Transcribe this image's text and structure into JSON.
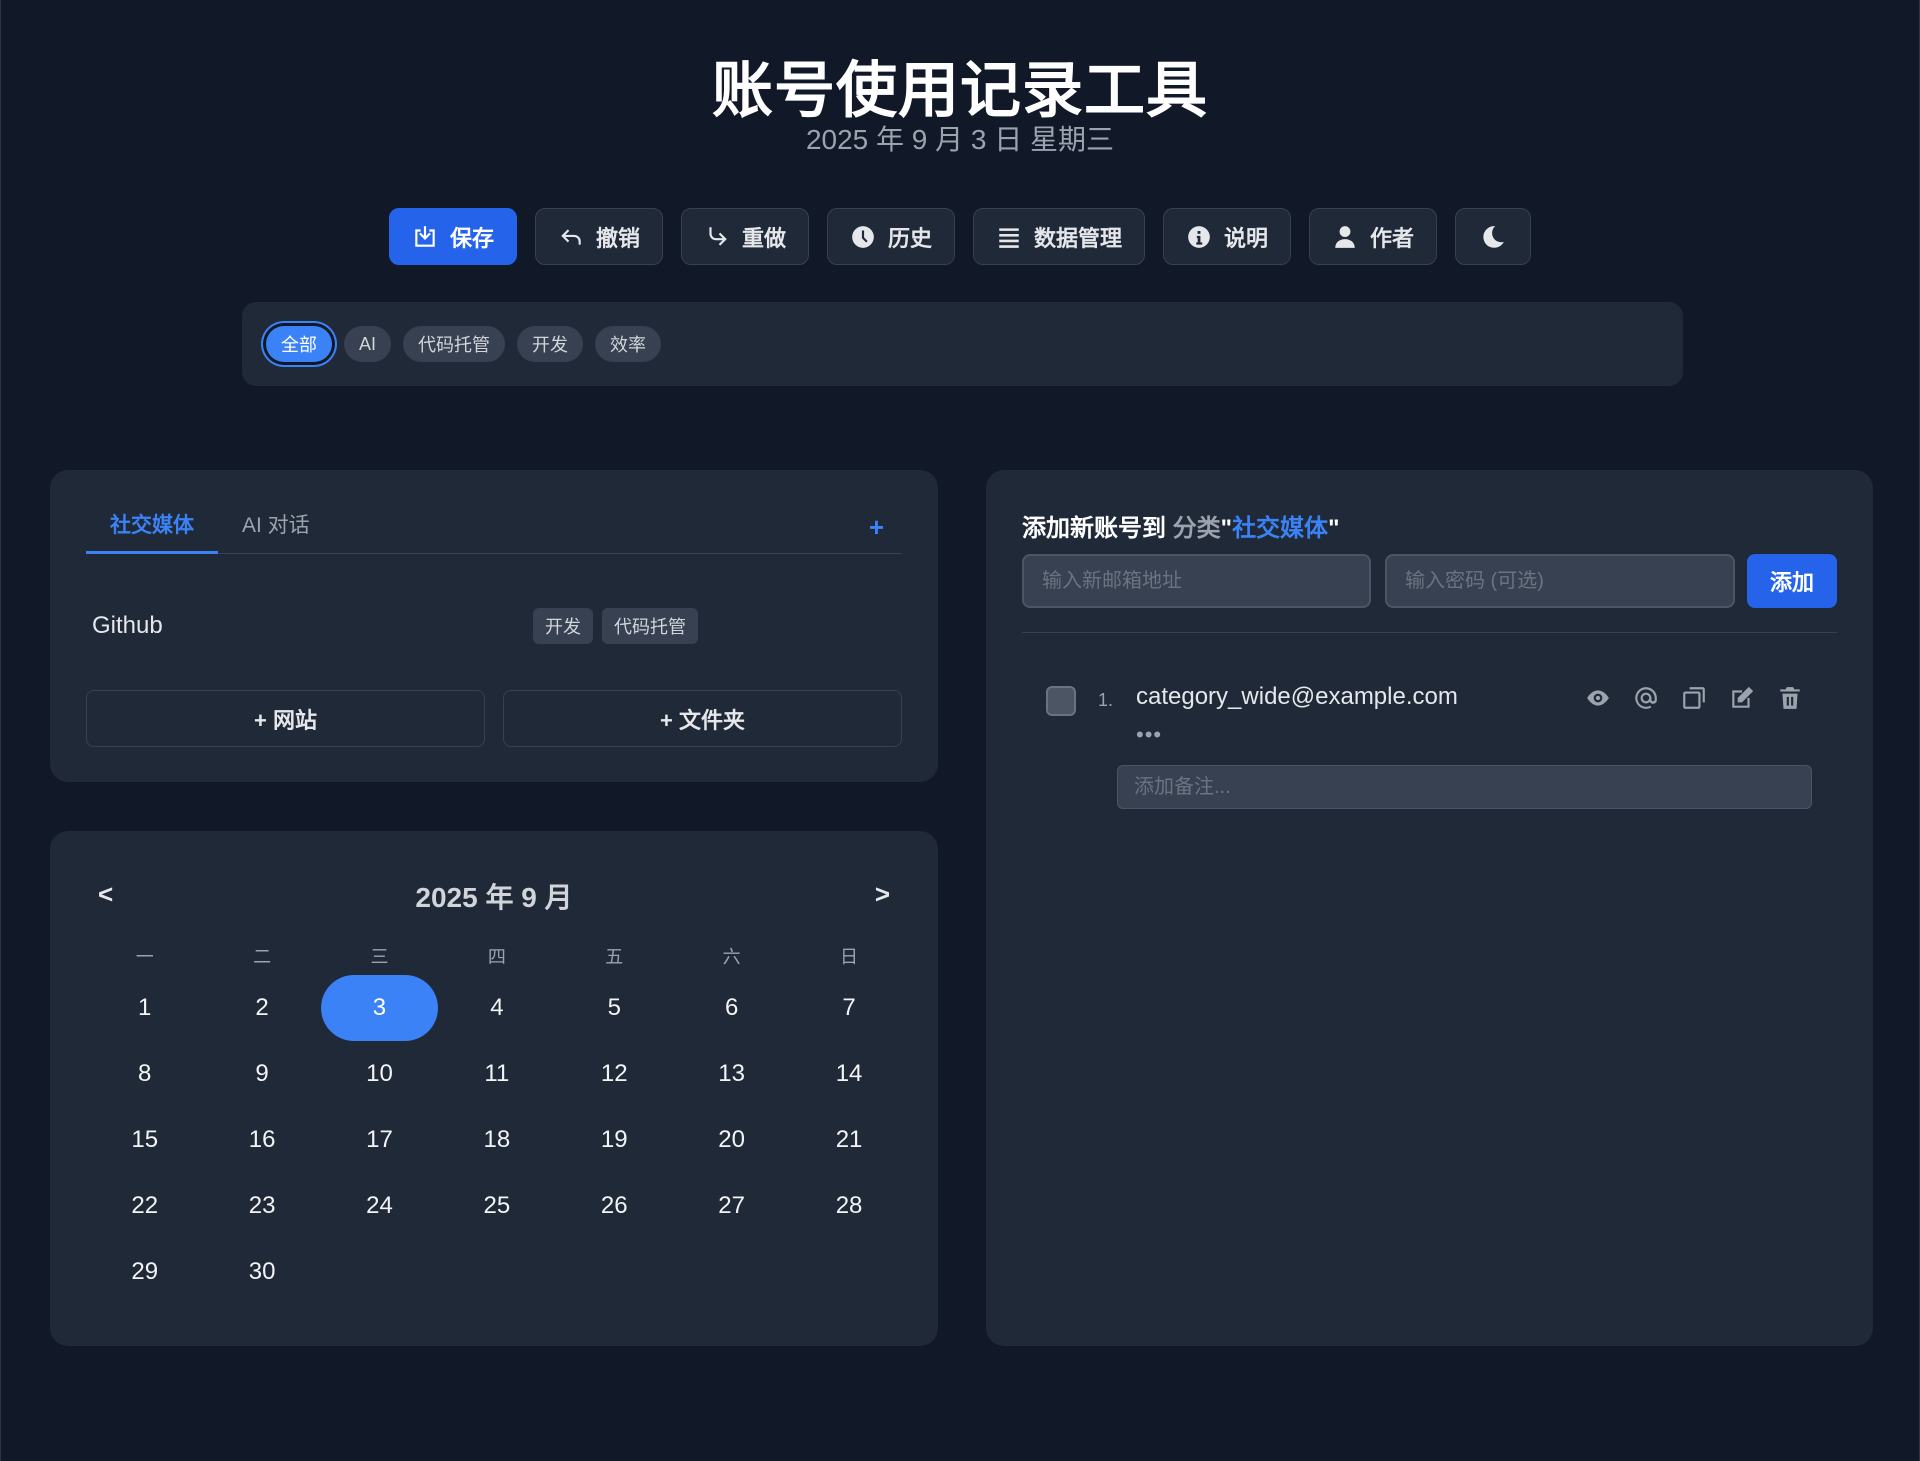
{
  "header": {
    "title": "账号使用记录工具",
    "subtitle": "2025 年 9 月 3 日 星期三"
  },
  "toolbar": {
    "save": "保存",
    "undo": "撤销",
    "redo": "重做",
    "history": "历史",
    "data_manage": "数据管理",
    "help": "说明",
    "author": "作者",
    "theme_icon": "moon-icon"
  },
  "filters": [
    "全部",
    "AI",
    "代码托管",
    "开发",
    "效率"
  ],
  "accounts_panel": {
    "tabs": [
      "社交媒体",
      "AI 对话"
    ],
    "add_tab": "+",
    "account": {
      "name": "Github",
      "tags": [
        "开发",
        "代码托管"
      ]
    },
    "add_site": "+ 网站",
    "add_folder": "+ 文件夹"
  },
  "calendar": {
    "title": "2025 年 9 月",
    "prev": "<",
    "next": ">",
    "weekdays": [
      "一",
      "二",
      "三",
      "四",
      "五",
      "六",
      "日"
    ],
    "days": [
      "1",
      "2",
      "3",
      "4",
      "5",
      "6",
      "7",
      "8",
      "9",
      "10",
      "11",
      "12",
      "13",
      "14",
      "15",
      "16",
      "17",
      "18",
      "19",
      "20",
      "21",
      "22",
      "23",
      "24",
      "25",
      "26",
      "27",
      "28",
      "29",
      "30"
    ],
    "today": "3"
  },
  "add_panel": {
    "title_prefix": "添加新账号到",
    "title_category": "分类",
    "title_quote_open": "\"",
    "title_name": "社交媒体",
    "title_quote_close": "\"",
    "email_placeholder": "输入新邮箱地址",
    "password_placeholder": "输入密码 (可选)",
    "add_button": "添加",
    "entry": {
      "index": "1.",
      "email": "category_wide@example.com",
      "more": "•••",
      "note_placeholder": "添加备注..."
    }
  },
  "colors": {
    "accent": "#3b82f6",
    "primary_button": "#2563eb",
    "background": "#111827",
    "panel": "#1f2937"
  }
}
